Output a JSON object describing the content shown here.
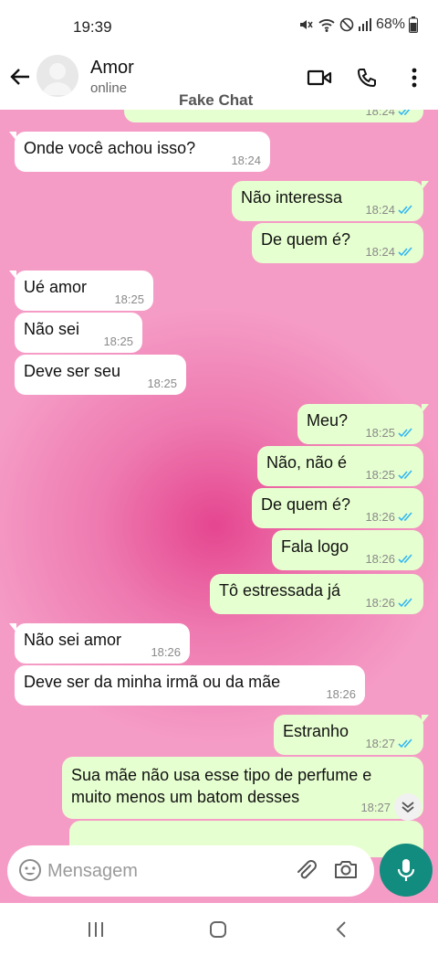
{
  "status_bar": {
    "time": "19:39",
    "battery": "68%",
    "icons": [
      "mute-icon",
      "wifi-icon",
      "no-disturb-icon",
      "signal-icon",
      "battery-icon"
    ]
  },
  "header": {
    "contact_name": "Amor",
    "contact_status": "online",
    "icons": [
      "back-arrow-icon",
      "video-call-icon",
      "phone-icon",
      "more-vert-icon"
    ]
  },
  "watermark": "Fake Chat",
  "colors": {
    "incoming_bubble": "#ffffff",
    "outgoing_bubble": "#e6ffd0",
    "read_tick": "#34b7f1",
    "mic_button": "#128c7e",
    "wallpaper": "#f59cc6"
  },
  "messages": [
    {
      "dir": "out",
      "text": "",
      "time": "18:24",
      "status": "read",
      "partial": "top"
    },
    {
      "dir": "in",
      "text": "Onde você achou isso?",
      "time": "18:24"
    },
    {
      "dir": "out",
      "text": "Não interessa",
      "time": "18:24",
      "status": "read"
    },
    {
      "dir": "out",
      "text": "De quem é?",
      "time": "18:24",
      "status": "read"
    },
    {
      "dir": "in",
      "text": "Ué amor",
      "time": "18:25"
    },
    {
      "dir": "in",
      "text": "Não sei",
      "time": "18:25"
    },
    {
      "dir": "in",
      "text": "Deve ser seu",
      "time": "18:25"
    },
    {
      "dir": "out",
      "text": "Meu?",
      "time": "18:25",
      "status": "read"
    },
    {
      "dir": "out",
      "text": "Não, não é",
      "time": "18:25",
      "status": "read"
    },
    {
      "dir": "out",
      "text": "De quem é?",
      "time": "18:26",
      "status": "read"
    },
    {
      "dir": "out",
      "text": "Fala logo",
      "time": "18:26",
      "status": "read"
    },
    {
      "dir": "out",
      "text": "Tô estressada já",
      "time": "18:26",
      "status": "read"
    },
    {
      "dir": "in",
      "text": "Não sei amor",
      "time": "18:26"
    },
    {
      "dir": "in",
      "text": "Deve ser da minha irmã ou da mãe",
      "time": "18:26"
    },
    {
      "dir": "out",
      "text": "Estranho",
      "time": "18:27",
      "status": "read"
    },
    {
      "dir": "out",
      "text": "Sua mãe não usa esse tipo de perfume e muito menos um batom desses",
      "time": "18:27"
    },
    {
      "dir": "out",
      "text": "",
      "time": "",
      "partial": "bottom"
    }
  ],
  "composer": {
    "placeholder": "Mensagem",
    "icons": [
      "emoji-icon",
      "attach-icon",
      "camera-icon",
      "mic-icon"
    ]
  },
  "nav": {
    "icons": [
      "recent-apps-icon",
      "home-icon",
      "back-icon"
    ]
  }
}
